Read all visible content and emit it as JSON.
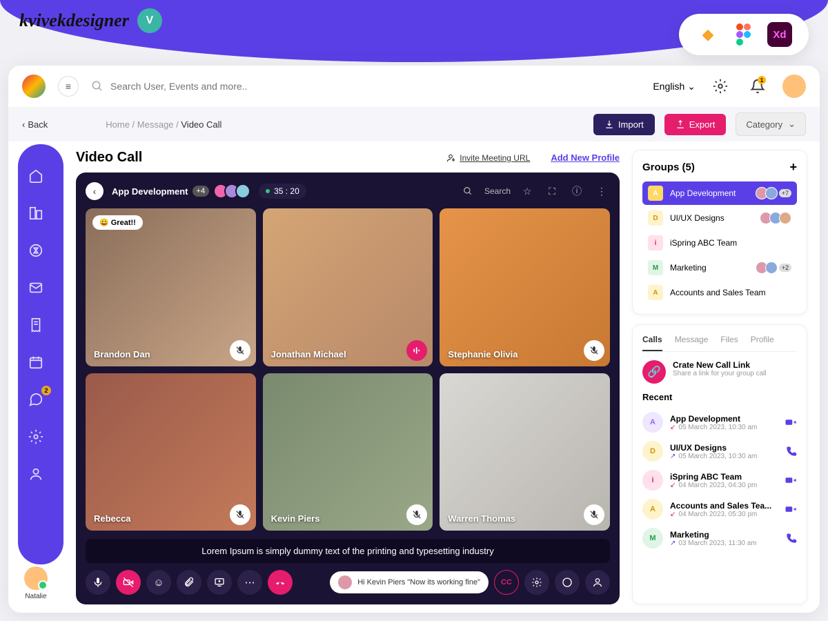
{
  "designer": {
    "name": "kvivekdesigner"
  },
  "topbar": {
    "search_placeholder": "Search User, Events and more..",
    "language": "English",
    "notification_count": "1"
  },
  "subbar": {
    "back": "Back",
    "crumb1": "Home",
    "crumb2": "Message",
    "crumb3": "Video Call",
    "import": "Import",
    "export": "Export",
    "category": "Category"
  },
  "sidebar": {
    "chat_badge": "2",
    "user_name": "Natalie"
  },
  "page": {
    "title": "Video Call",
    "invite": "Invite Meeting URL",
    "add_profile": "Add New Profile"
  },
  "call": {
    "title": "App Development",
    "extra": "+4",
    "timer": "35 : 20",
    "search": "Search",
    "participants": [
      {
        "name": "Brandon Dan",
        "reaction": "Great!!",
        "speaking": false
      },
      {
        "name": "Jonathan Michael",
        "speaking": true
      },
      {
        "name": "Stephanie Olivia",
        "speaking": false
      },
      {
        "name": "Rebecca",
        "speaking": false
      },
      {
        "name": "Kevin Piers",
        "speaking": false
      },
      {
        "name": "Warren Thomas",
        "speaking": false
      }
    ],
    "caption": "Lorem Ipsum is simply dummy text of the printing and typesetting industry",
    "message": "Hi Kevin Piers \"Now its working fine\"",
    "cc": "CC"
  },
  "groups": {
    "title": "Groups (5)",
    "items": [
      {
        "letter": "A",
        "name": "App Development",
        "badge": "+7",
        "color": "#fff",
        "bg": "#ffd966",
        "active": true
      },
      {
        "letter": "D",
        "name": "UI/UX Designs",
        "color": "#cc9900",
        "bg": "#fff3cc"
      },
      {
        "letter": "i",
        "name": "iSpring ABC Team",
        "color": "#e61c6d",
        "bg": "#ffe0ec"
      },
      {
        "letter": "M",
        "name": "Marketing",
        "badge": "+2",
        "color": "#2a9d4a",
        "bg": "#e0f5e6"
      },
      {
        "letter": "A",
        "name": "Accounts and Sales Team",
        "color": "#cc9900",
        "bg": "#fff3cc"
      }
    ]
  },
  "callcard": {
    "tabs": [
      "Calls",
      "Message",
      "Files",
      "Profile"
    ],
    "newcall_title": "Crate New Call Link",
    "newcall_sub": "Share a link for your group call",
    "recent_title": "Recent",
    "recent": [
      {
        "letter": "A",
        "bg": "#efe6ff",
        "color": "#8a6ee6",
        "name": "App Development",
        "dir": "in",
        "time": "05 March 2023, 10:30 am",
        "type": "video"
      },
      {
        "letter": "D",
        "bg": "#fff3cc",
        "color": "#cc9900",
        "name": "UI/UX Designs",
        "dir": "out",
        "time": "05 March 2023, 10:30 am",
        "type": "phone"
      },
      {
        "letter": "i",
        "bg": "#ffe0ec",
        "color": "#e61c6d",
        "name": "iSpring ABC Team",
        "dir": "in",
        "time": "04 March 2023, 04:30 pm",
        "type": "video"
      },
      {
        "letter": "A",
        "bg": "#fff3cc",
        "color": "#cc9900",
        "name": "Accounts and Sales Tea...",
        "dir": "in",
        "time": "04 March 2023, 05:30 pm",
        "type": "video"
      },
      {
        "letter": "M",
        "bg": "#e0f5e6",
        "color": "#2a9d4a",
        "name": "Marketing",
        "dir": "out",
        "time": "03 March 2023, 11:30 am",
        "type": "phone"
      }
    ]
  }
}
